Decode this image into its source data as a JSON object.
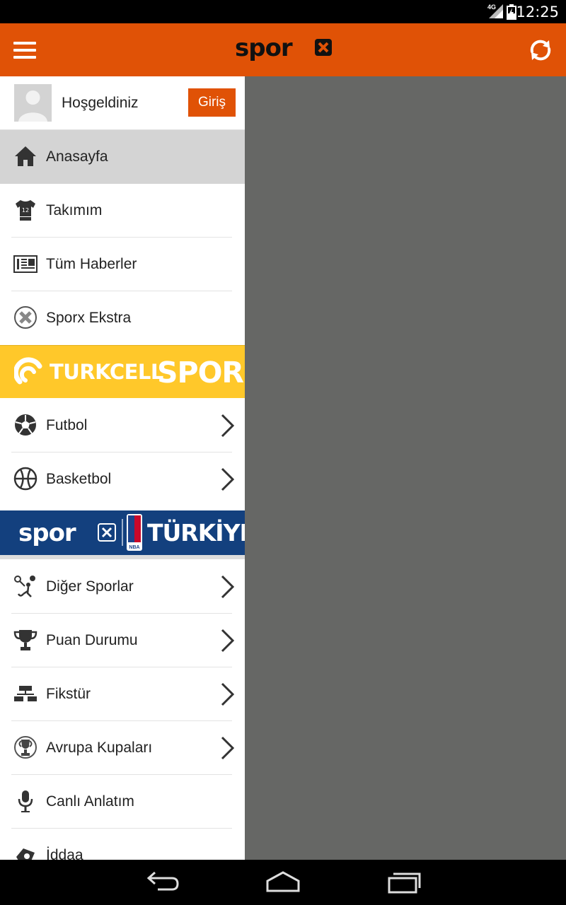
{
  "status_bar": {
    "network": "4G",
    "time": "12:25"
  },
  "header": {
    "logo_text": "spor",
    "menu_icon": "hamburger-menu-icon",
    "refresh_icon": "refresh-icon",
    "colors": {
      "bar": "#e05206",
      "logo": "#111111"
    }
  },
  "drawer": {
    "profile": {
      "welcome": "Hoşgeldiniz",
      "login_label": "Giriş"
    },
    "items": [
      {
        "label": "Anasayfa",
        "icon": "home-icon",
        "active": true
      },
      {
        "label": "Takımım",
        "icon": "jersey-icon"
      },
      {
        "label": "Tüm Haberler",
        "icon": "newspaper-icon"
      },
      {
        "label": "Sporx Ekstra",
        "icon": "sporx-x-icon"
      }
    ],
    "turkcell_banner": {
      "brand": "TURKCELL",
      "word": "SPOR",
      "color": "#ffc82a"
    },
    "items2": [
      {
        "label": "Futbol",
        "icon": "football-icon",
        "chevron": true
      },
      {
        "label": "Basketbol",
        "icon": "basketball-icon",
        "chevron": true
      }
    ],
    "nba_banner": {
      "brand": "spor",
      "nba": "NBA",
      "country": "TÜRKİYE",
      "color": "#13407e"
    },
    "items3": [
      {
        "label": "Diğer Sporlar",
        "icon": "other-sports-icon",
        "chevron": true
      },
      {
        "label": "Puan Durumu",
        "icon": "trophy-icon",
        "chevron": true
      },
      {
        "label": "Fikstür",
        "icon": "fixture-bracket-icon",
        "chevron": true
      },
      {
        "label": "Avrupa Kupaları",
        "icon": "european-cup-icon",
        "chevron": true
      },
      {
        "label": "Canlı Anlatım",
        "icon": "microphone-icon"
      },
      {
        "label": "İddaa",
        "icon": "iddaa-icon"
      }
    ]
  },
  "nav_bar": {
    "back_icon": "back-icon",
    "home_icon": "home-nav-icon",
    "recents_icon": "recents-icon"
  },
  "colors": {
    "accent": "#e05206",
    "content_bg": "#666765",
    "active_item": "#d4d4d4"
  }
}
